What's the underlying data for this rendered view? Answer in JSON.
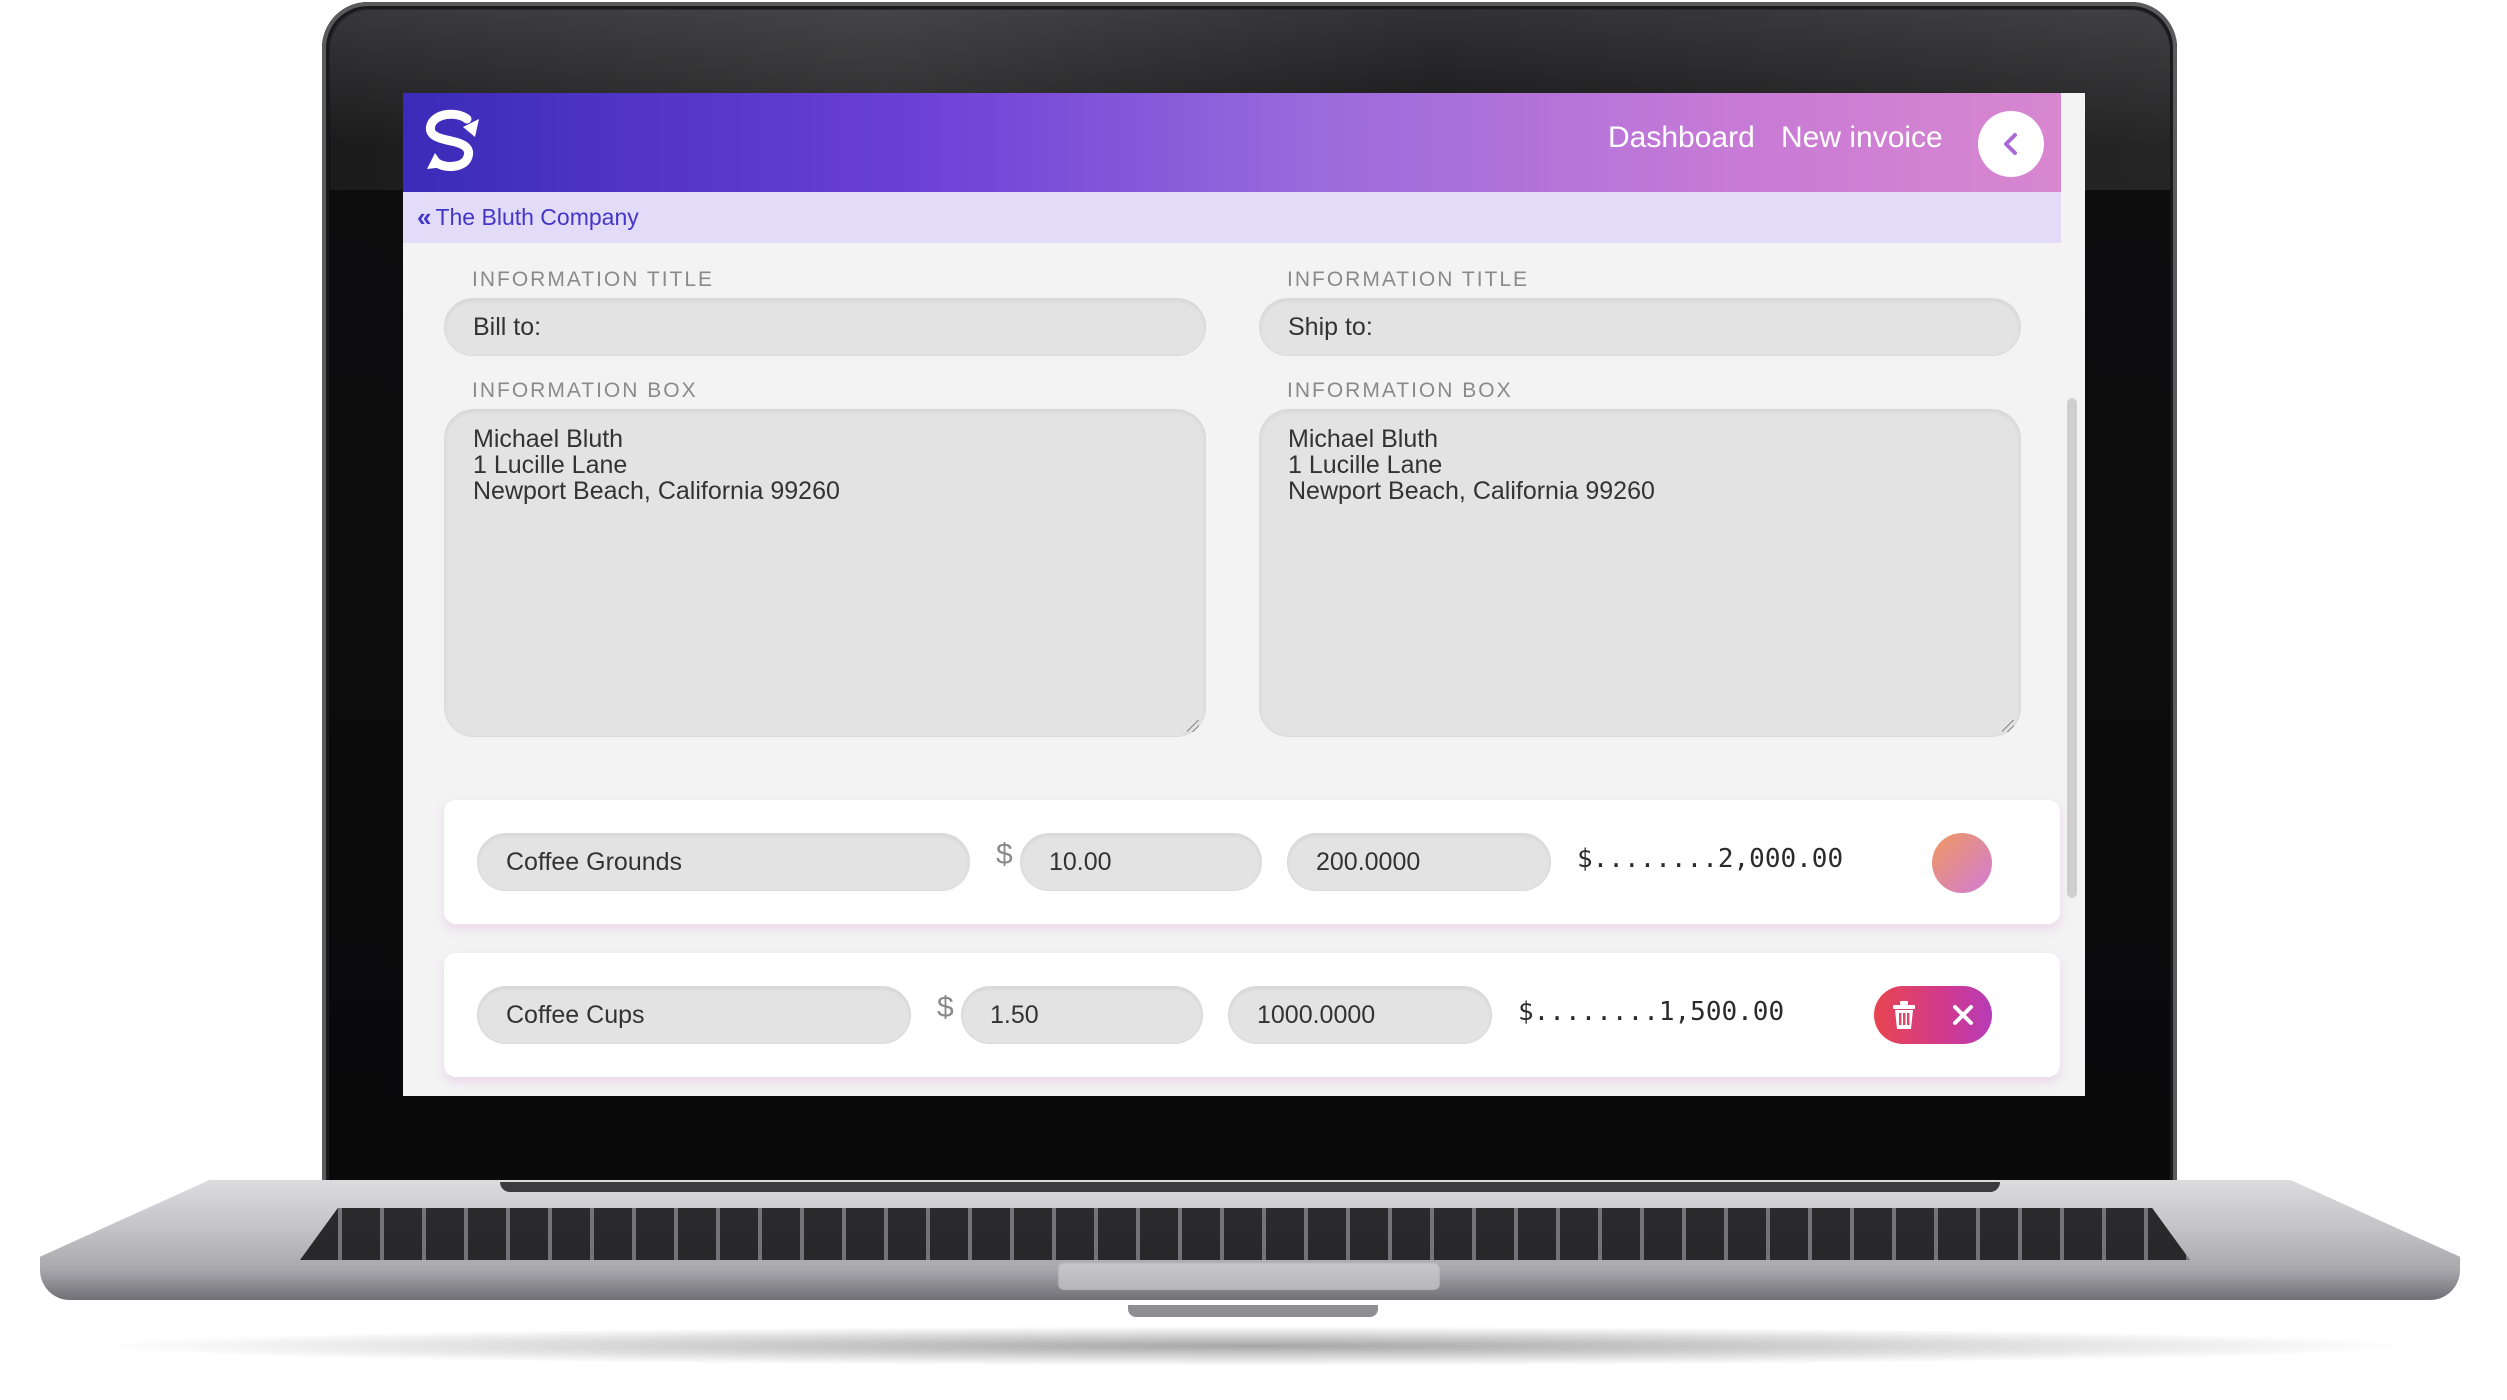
{
  "header": {
    "nav": {
      "dashboard": "Dashboard",
      "new_invoice": "New invoice"
    }
  },
  "breadcrumb": {
    "label": "The Bluth Company"
  },
  "bill": {
    "title_label": "INFORMATION TITLE",
    "title_value": "Bill to:",
    "box_label": "INFORMATION BOX",
    "box_lines": [
      "Michael Bluth",
      "1 Lucille Lane",
      "Newport Beach, California 99260"
    ]
  },
  "ship": {
    "title_label": "INFORMATION TITLE",
    "title_value": "Ship to:",
    "box_label": "INFORMATION BOX",
    "box_lines": [
      "Michael Bluth",
      "1 Lucille Lane",
      "Newport Beach, California 99260"
    ]
  },
  "line_items": [
    {
      "description": "Coffee Grounds",
      "currency": "$",
      "price": "10.00",
      "quantity": "200.0000",
      "total": "$........2,000.00"
    },
    {
      "description": "Coffee Cups",
      "currency": "$",
      "price": "1.50",
      "quantity": "1000.0000",
      "total": "$........1,500.00"
    }
  ],
  "colors": {
    "header_start": "#3a2bb8",
    "header_end": "#d887cf",
    "accent": "#4436c8",
    "delete_start": "#e8454f",
    "delete_end": "#b63bb6"
  },
  "icons": {
    "logo": "s-logo-icon",
    "back": "chevron-left-icon",
    "breadcrumb": "double-chevron-left-icon",
    "delete": "trash-icon",
    "cancel": "close-icon"
  }
}
